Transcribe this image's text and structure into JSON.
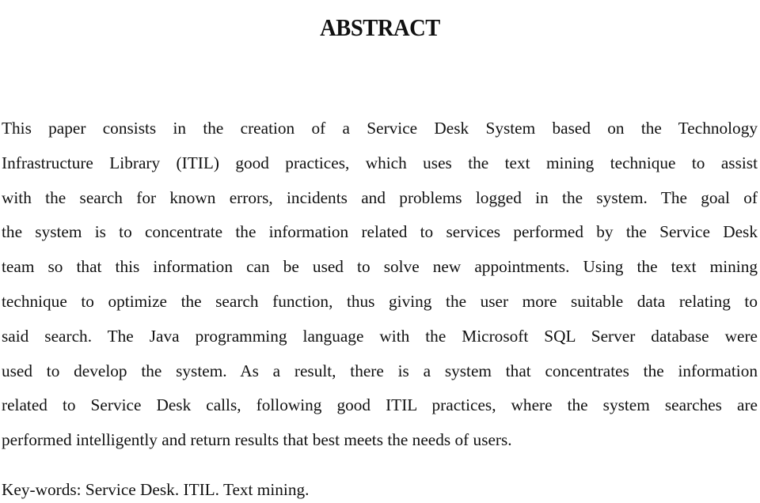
{
  "document": {
    "title": "ABSTRACT",
    "abstract_lines": [
      "This paper consists in the creation of a Service Desk System based on the Technology",
      "Infrastructure Library (ITIL) good practices, which uses the text mining technique to assist",
      "with the search for known errors, incidents and problems logged in the system. The goal of",
      "the system is to concentrate the information related to services performed by the Service Desk",
      "team so that this information can be used to solve new appointments. Using the text mining",
      "technique to optimize the search function, thus giving the user more suitable data relating to",
      "said search. The Java programming language with the Microsoft SQL Server database were",
      "used to develop the system. As a result, there is a system that concentrates the information",
      "related to Service Desk calls, following good ITIL practices, where the system searches are",
      "performed intelligently and return results that best meets the needs of users."
    ],
    "keywords": "Key-words: Service Desk. ITIL. Text mining."
  }
}
